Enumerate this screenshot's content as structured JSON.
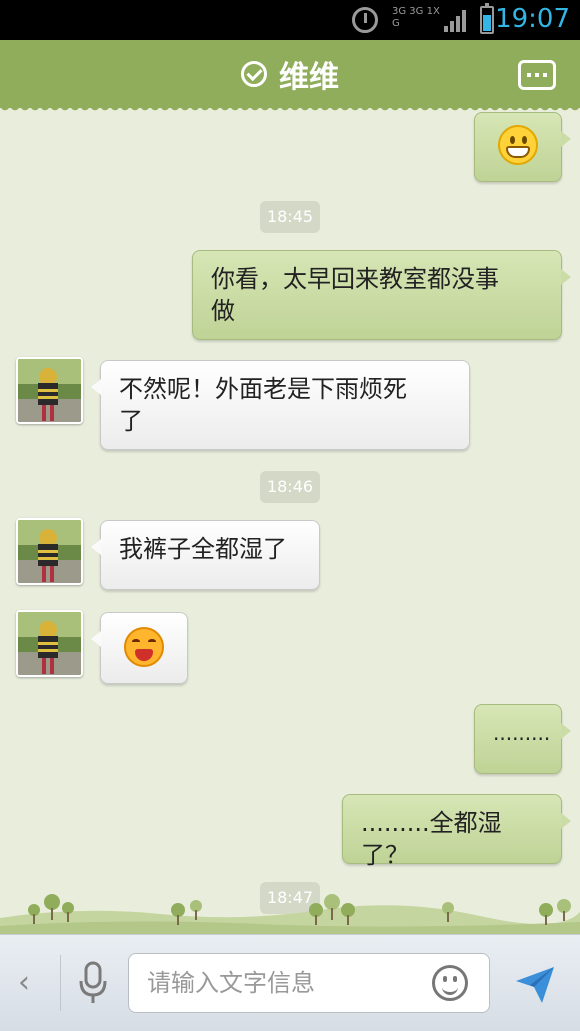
{
  "status_bar": {
    "network": "3G 3G 1X G",
    "time": "19:07",
    "colors": {
      "accent": "#33b5e5",
      "icon": "#9a9a9a"
    }
  },
  "header": {
    "title": "维维",
    "color": "#8fad5a"
  },
  "messages": [
    {
      "type": "emoji",
      "direction": "out",
      "emoji": "grinning-face-emoji"
    },
    {
      "type": "time",
      "text": "18:45"
    },
    {
      "type": "text",
      "direction": "out",
      "lines": [
        "你看，太早回来教室都没事",
        "做"
      ]
    },
    {
      "type": "text",
      "direction": "in",
      "lines": [
        "不然呢！外面老是下雨烦死",
        "了"
      ]
    },
    {
      "type": "time",
      "text": "18:46"
    },
    {
      "type": "text",
      "direction": "in",
      "lines": [
        "我裤子全都湿了"
      ]
    },
    {
      "type": "emoji",
      "direction": "in",
      "emoji": "laughing-face-emoji"
    },
    {
      "type": "text",
      "direction": "out",
      "lines": [
        "........."
      ]
    },
    {
      "type": "text",
      "direction": "out",
      "lines": [
        ".........全都湿了？"
      ]
    },
    {
      "type": "time",
      "text": "18:47"
    }
  ],
  "input_bar": {
    "back_label": "‹",
    "placeholder": "请输入文字信息"
  }
}
